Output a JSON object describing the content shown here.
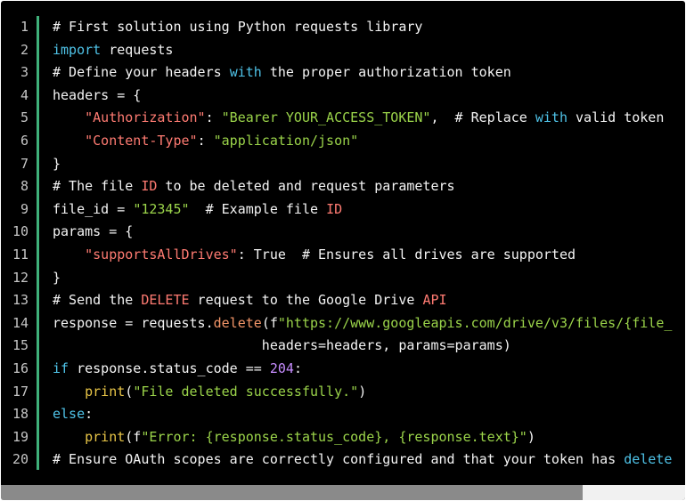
{
  "gutter": {
    "lines": [
      "1",
      "2",
      "3",
      "4",
      "5",
      "6",
      "7",
      "8",
      "9",
      "10",
      "11",
      "12",
      "13",
      "14",
      "15",
      "16",
      "17",
      "18",
      "19",
      "20"
    ]
  },
  "code": {
    "lines": [
      [
        {
          "t": "comment",
          "v": "# First solution using Python requests library"
        }
      ],
      [
        {
          "t": "keyword",
          "v": "import"
        },
        {
          "t": "plain",
          "v": " requests"
        }
      ],
      [
        {
          "t": "comment",
          "v": "# Define your headers "
        },
        {
          "t": "keyword",
          "v": "with"
        },
        {
          "t": "comment",
          "v": " the proper authorization token"
        }
      ],
      [
        {
          "t": "plain",
          "v": "headers = {"
        }
      ],
      [
        {
          "t": "plain",
          "v": "    "
        },
        {
          "t": "key",
          "v": "\"Authorization\""
        },
        {
          "t": "plain",
          "v": ": "
        },
        {
          "t": "string",
          "v": "\"Bearer YOUR_ACCESS_TOKEN\""
        },
        {
          "t": "plain",
          "v": ",  # Replace "
        },
        {
          "t": "keyword",
          "v": "with"
        },
        {
          "t": "plain",
          "v": " valid token"
        }
      ],
      [
        {
          "t": "plain",
          "v": "    "
        },
        {
          "t": "key",
          "v": "\"Content-Type\""
        },
        {
          "t": "plain",
          "v": ": "
        },
        {
          "t": "string",
          "v": "\"application/json\""
        }
      ],
      [
        {
          "t": "plain",
          "v": "}"
        }
      ],
      [
        {
          "t": "comment",
          "v": "# The file "
        },
        {
          "t": "hl",
          "v": "ID"
        },
        {
          "t": "comment",
          "v": " to be deleted and request parameters"
        }
      ],
      [
        {
          "t": "plain",
          "v": "file_id = "
        },
        {
          "t": "string",
          "v": "\"12345\""
        },
        {
          "t": "plain",
          "v": "  # Example file "
        },
        {
          "t": "hl",
          "v": "ID"
        }
      ],
      [
        {
          "t": "plain",
          "v": "params = {"
        }
      ],
      [
        {
          "t": "plain",
          "v": "    "
        },
        {
          "t": "key",
          "v": "\"supportsAllDrives\""
        },
        {
          "t": "plain",
          "v": ": True  # Ensures all drives are supported"
        }
      ],
      [
        {
          "t": "plain",
          "v": "}"
        }
      ],
      [
        {
          "t": "comment",
          "v": "# Send the "
        },
        {
          "t": "hl",
          "v": "DELETE"
        },
        {
          "t": "comment",
          "v": " request to the Google Drive "
        },
        {
          "t": "hl",
          "v": "API"
        }
      ],
      [
        {
          "t": "plain",
          "v": "response = requests."
        },
        {
          "t": "fn",
          "v": "delete"
        },
        {
          "t": "plain",
          "v": "(f"
        },
        {
          "t": "string",
          "v": "\"https://www.googleapis.com/drive/v3/files/{file_"
        }
      ],
      [
        {
          "t": "plain",
          "v": "                          headers=headers, params=params)"
        }
      ],
      [
        {
          "t": "keyword",
          "v": "if"
        },
        {
          "t": "plain",
          "v": " response.status_code == "
        },
        {
          "t": "number",
          "v": "204"
        },
        {
          "t": "plain",
          "v": ":"
        }
      ],
      [
        {
          "t": "plain",
          "v": "    "
        },
        {
          "t": "builtin",
          "v": "print"
        },
        {
          "t": "plain",
          "v": "("
        },
        {
          "t": "string",
          "v": "\"File deleted successfully.\""
        },
        {
          "t": "plain",
          "v": ")"
        }
      ],
      [
        {
          "t": "keyword",
          "v": "else"
        },
        {
          "t": "plain",
          "v": ":"
        }
      ],
      [
        {
          "t": "plain",
          "v": "    "
        },
        {
          "t": "builtin",
          "v": "print"
        },
        {
          "t": "plain",
          "v": "(f"
        },
        {
          "t": "string",
          "v": "\"Error: {response.status_code}, {response.text}\""
        },
        {
          "t": "plain",
          "v": ")"
        }
      ],
      [
        {
          "t": "comment",
          "v": "# Ensure OAuth scopes are correctly configured and that your token has "
        },
        {
          "t": "keyword",
          "v": "delete"
        }
      ]
    ]
  },
  "scrollbar": {
    "horizontal_visible_fraction": 0.85
  },
  "colors": {
    "background": "#000000",
    "gutter_rule": "#3fb07a",
    "keyword": "#4fc3e8",
    "string": "#9bd44a",
    "key": "#ff7b72",
    "number": "#c78dff"
  }
}
